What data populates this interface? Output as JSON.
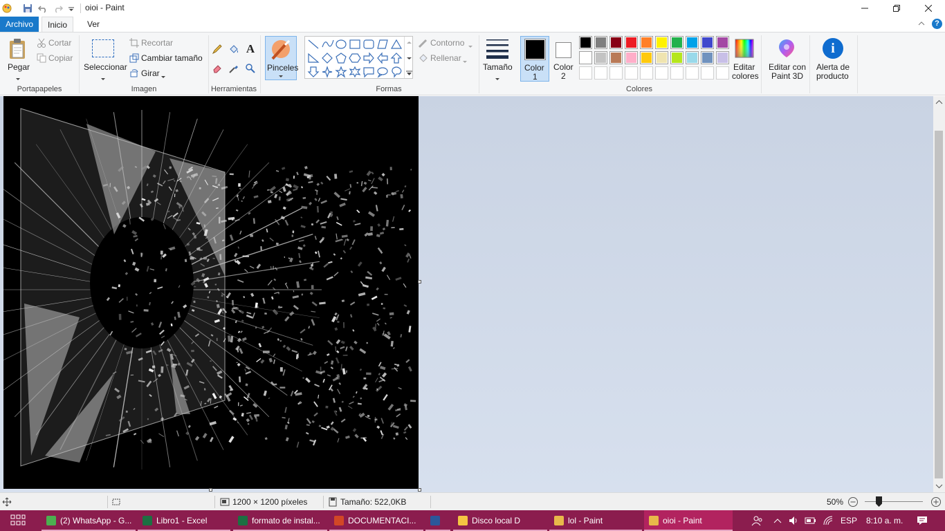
{
  "window": {
    "title": "oioi - Paint"
  },
  "tabs": {
    "archivo": "Archivo",
    "inicio": "Inicio",
    "ver": "Ver"
  },
  "clipboard": {
    "paste": "Pegar",
    "cut": "Cortar",
    "copy": "Copiar",
    "group": "Portapapeles"
  },
  "image": {
    "select": "Seleccionar",
    "crop": "Recortar",
    "resize": "Cambiar tamaño",
    "rotate": "Girar",
    "group": "Imagen"
  },
  "tools": {
    "group": "Herramientas",
    "brushes": "Pinceles"
  },
  "shapes": {
    "outline": "Contorno",
    "fill": "Rellenar",
    "group": "Formas"
  },
  "size": {
    "label": "Tamaño"
  },
  "colors": {
    "color1_line1": "Color",
    "color1_line2": "1",
    "color2_line1": "Color",
    "color2_line2": "2",
    "edit_line1": "Editar",
    "edit_line2": "colores",
    "group": "Colores",
    "color1_value": "#000000",
    "color2_value": "#ffffff",
    "palette_row1": [
      "#000000",
      "#7f7f7f",
      "#880015",
      "#ed1c24",
      "#ff7f27",
      "#fff200",
      "#22b14c",
      "#00a2e8",
      "#3f48cc",
      "#a349a4"
    ],
    "palette_row2": [
      "#ffffff",
      "#c3c3c3",
      "#b97a57",
      "#ffaec9",
      "#ffc90e",
      "#efe4b0",
      "#b5e61d",
      "#99d9ea",
      "#7092be",
      "#c8bfe7"
    ]
  },
  "paint3d": {
    "line1": "Editar con",
    "line2": "Paint 3D"
  },
  "alert": {
    "line1": "Alerta de",
    "line2": "producto"
  },
  "status": {
    "dimensions": "1200 × 1200 píxeles",
    "size": "Tamaño: 522,0KB",
    "zoom": "50%"
  },
  "taskbar": {
    "items": [
      {
        "label": "(2) WhatsApp - G...",
        "color": "#4caf50"
      },
      {
        "label": "Libro1 - Excel",
        "color": "#1d6f42"
      },
      {
        "label": "formato de instal...",
        "color": "#1d6f42"
      },
      {
        "label": "DOCUMENTACI...",
        "color": "#d24726"
      },
      {
        "label": "",
        "color": "#2b579a"
      },
      {
        "label": "Disco local D",
        "color": "#f4c542"
      },
      {
        "label": "lol - Paint",
        "color": "#e8b84a"
      },
      {
        "label": "oioi - Paint",
        "color": "#e8b84a"
      }
    ],
    "language": "ESP",
    "time": "8:10 a. m."
  }
}
